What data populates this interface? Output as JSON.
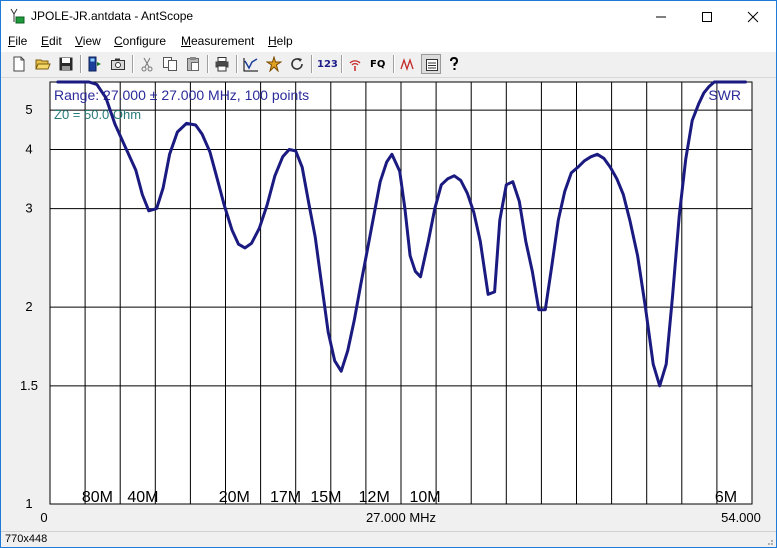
{
  "window": {
    "title": "JPOLE-JR.antdata - AntScope",
    "controls": [
      "minimize",
      "maximize",
      "close"
    ]
  },
  "menu": {
    "items": [
      {
        "label": "File",
        "mnemonic": "F",
        "rest": "ile"
      },
      {
        "label": "Edit",
        "mnemonic": "E",
        "rest": "dit"
      },
      {
        "label": "View",
        "mnemonic": "V",
        "rest": "iew"
      },
      {
        "label": "Configure",
        "mnemonic": "C",
        "rest": "onfigure"
      },
      {
        "label": "Measurement",
        "mnemonic": "M",
        "rest": "easurement"
      },
      {
        "label": "Help",
        "mnemonic": "H",
        "rest": "elp"
      }
    ]
  },
  "toolbar": {
    "icons": [
      "new-file-icon",
      "open-folder-icon",
      "save-icon",
      "analyzer-icon",
      "screenshot-icon",
      "cut-icon",
      "copy-icon",
      "paste-icon",
      "print-icon",
      "plot-icon",
      "auto-scale-icon",
      "refresh-icon",
      "numbers-icon",
      "antenna-icon",
      "frequency-icon",
      "markers-icon",
      "notes-icon",
      "help-icon"
    ],
    "numbers_label": "123",
    "frequency_label": "FQ"
  },
  "chart_data": {
    "type": "line",
    "info_line": "Range: 27.000 ± 27.000 MHz, 100 points",
    "z0_line": "Z0 = 50.0 Ohm",
    "series_label": "SWR",
    "x_tick_labels": [
      "0",
      "27.000 MHz",
      "54.000"
    ],
    "xlim": [
      0,
      54
    ],
    "y_tick_labels": [
      "1",
      "1.5",
      "2",
      "3",
      "4",
      "5"
    ],
    "y_ticks": [
      1,
      1.5,
      2,
      3,
      4,
      5
    ],
    "ylim": [
      1,
      6
    ],
    "y_scale": "swr",
    "grid": true,
    "band_markers": [
      {
        "label": "80M",
        "x": 3.65
      },
      {
        "label": "40M",
        "x": 7.15
      },
      {
        "label": "20M",
        "x": 14.175
      },
      {
        "label": "17M",
        "x": 18.118
      },
      {
        "label": "15M",
        "x": 21.225
      },
      {
        "label": "12M",
        "x": 24.94
      },
      {
        "label": "10M",
        "x": 28.85
      },
      {
        "label": "6M",
        "x": 52.0
      }
    ],
    "series": [
      {
        "line_color": "#1a1a80",
        "x": [
          0.6,
          3.0,
          3.6,
          4.3,
          5.0,
          5.8,
          6.6,
          7.1,
          7.6,
          8.2,
          8.7,
          9.2,
          9.8,
          10.5,
          11.2,
          11.7,
          12.3,
          12.8,
          13.4,
          14.0,
          14.5,
          15.0,
          15.5,
          16.1,
          16.7,
          17.3,
          17.9,
          18.4,
          18.9,
          19.4,
          19.9,
          20.4,
          20.9,
          21.4,
          21.9,
          22.4,
          22.9,
          23.4,
          23.9,
          24.4,
          24.9,
          25.4,
          25.9,
          26.3,
          26.9,
          27.3,
          27.7,
          28.1,
          28.5,
          29.1,
          29.6,
          30.1,
          30.6,
          31.1,
          31.6,
          32.1,
          32.6,
          33.1,
          33.7,
          34.2,
          34.6,
          35.1,
          35.6,
          36.1,
          36.6,
          37.1,
          37.6,
          38.1,
          38.6,
          39.1,
          39.6,
          40.1,
          40.6,
          41.1,
          41.6,
          42.1,
          42.6,
          43.1,
          43.6,
          44.1,
          44.6,
          45.2,
          45.8,
          46.4,
          46.9,
          47.4,
          47.9,
          48.4,
          48.9,
          49.4,
          49.9,
          50.3,
          50.7,
          51.1,
          51.5,
          52.0,
          52.4,
          52.9,
          53.5
        ],
        "y": [
          6.0,
          6.0,
          5.9,
          5.4,
          4.6,
          4.05,
          3.6,
          3.2,
          2.97,
          3.0,
          3.3,
          3.9,
          4.4,
          4.62,
          4.58,
          4.35,
          3.95,
          3.5,
          3.05,
          2.73,
          2.57,
          2.53,
          2.58,
          2.75,
          3.05,
          3.5,
          3.85,
          4.0,
          3.97,
          3.65,
          3.08,
          2.65,
          2.18,
          1.82,
          1.64,
          1.58,
          1.7,
          1.9,
          2.18,
          2.5,
          2.9,
          3.4,
          3.75,
          3.9,
          3.58,
          3.0,
          2.45,
          2.3,
          2.25,
          2.6,
          3.0,
          3.35,
          3.45,
          3.5,
          3.42,
          3.22,
          2.95,
          2.6,
          2.1,
          2.12,
          2.85,
          3.35,
          3.4,
          3.1,
          2.6,
          2.3,
          1.98,
          1.98,
          2.35,
          2.85,
          3.25,
          3.55,
          3.65,
          3.77,
          3.85,
          3.9,
          3.82,
          3.65,
          3.45,
          3.2,
          2.85,
          2.45,
          2.0,
          1.62,
          1.5,
          1.62,
          2.1,
          2.9,
          3.8,
          4.7,
          5.2,
          5.58,
          5.82,
          6.0,
          6.0,
          6.0,
          6.0,
          6.0,
          6.0
        ]
      }
    ]
  },
  "status": {
    "text": "770x448"
  }
}
